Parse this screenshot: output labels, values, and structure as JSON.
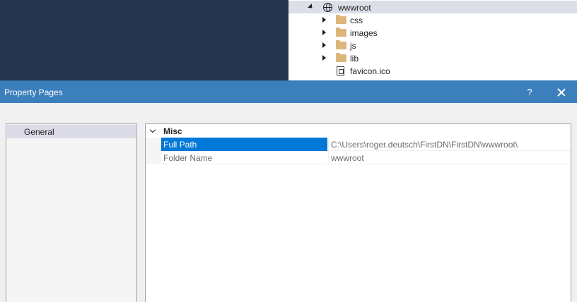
{
  "solution_explorer": {
    "items": [
      {
        "label": "wwwroot",
        "icon": "globe-icon",
        "expanded": true,
        "selected": true
      },
      {
        "label": "css",
        "icon": "folder-icon"
      },
      {
        "label": "images",
        "icon": "folder-icon"
      },
      {
        "label": "js",
        "icon": "folder-icon"
      },
      {
        "label": "lib",
        "icon": "folder-icon"
      },
      {
        "label": "favicon.ico",
        "icon": "file-icon"
      }
    ]
  },
  "dialog": {
    "title": "Property Pages",
    "help_label": "?",
    "nav": {
      "items": [
        {
          "label": "General",
          "selected": true
        }
      ]
    },
    "grid": {
      "category": "Misc",
      "properties": [
        {
          "name": "Full Path",
          "value": "C:\\Users\\roger.deutsch\\FirstDN\\FirstDN\\wwwroot\\",
          "selected": true
        },
        {
          "name": "Folder Name",
          "value": "wwwroot",
          "selected": false
        }
      ]
    }
  },
  "colors": {
    "titlebar": "#3c7fbd",
    "selection": "#0078d7",
    "editor_bg": "#263550",
    "folder": "#dcb67a"
  }
}
